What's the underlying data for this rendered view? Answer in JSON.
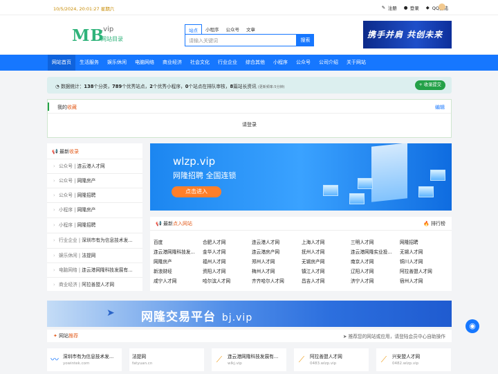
{
  "topbar": {
    "date": "10/5/2024, 20:01:27 星期六",
    "register": "注册",
    "login": "登录",
    "qq_login": "QQ登陆"
  },
  "logo": {
    "mb": "MB",
    "vip": ".vip",
    "cn": "网站目录"
  },
  "search": {
    "tabs": [
      "站点",
      "小程序",
      "公众号",
      "文章"
    ],
    "placeholder": "请输入关键词",
    "button": "搜索"
  },
  "header_banner": "携手并肩 共创未来",
  "nav": [
    "网站首页",
    "生活服务",
    "娱乐休闲",
    "电脑网络",
    "商业经济",
    "社会文化",
    "行业企业",
    "综合其他",
    "小程序",
    "公众号",
    "公司介绍",
    "关于网站"
  ],
  "stats": {
    "label": "数据统计：",
    "cat_count": "138",
    "cat_text": "个分类，",
    "good_count": "789",
    "good_text": "个优秀站点，",
    "mini_count": "2",
    "mini_text": "个优秀小程序，",
    "queue_count": "0",
    "queue_text": "个站点在排队审核，",
    "news_count": "8",
    "news_text": "篇站长资讯",
    "update_note": "(更新频率:5分钟)",
    "submit_button": "收录提交"
  },
  "favorites": {
    "title_a": "我的",
    "title_b": "收藏",
    "edit": "编辑",
    "login_prompt": "请登录"
  },
  "latest": {
    "title_a": "最新",
    "title_b": "收录",
    "items": [
      {
        "cat": "公众号",
        "name": "连云港人才网"
      },
      {
        "cat": "公众号",
        "name": "网隆房产"
      },
      {
        "cat": "公众号",
        "name": "网隆招聘"
      },
      {
        "cat": "小程序",
        "name": "网隆房产"
      },
      {
        "cat": "小程序",
        "name": "网隆招聘"
      },
      {
        "cat": "行业企业",
        "name": "深圳市有为信息技术发..."
      },
      {
        "cat": "娱乐休闲",
        "name": "法提网"
      },
      {
        "cat": "电脑网络",
        "name": "连云港网隆科技发展有..."
      },
      {
        "cat": "商业经济",
        "name": "阿拉善盟人才网"
      }
    ]
  },
  "ad_wlzp": {
    "domain": "wlzp.vip",
    "slogan": "网隆招聘  全国连锁",
    "button": "点击进入"
  },
  "hot": {
    "title_a": "最新",
    "title_b": "点入网站",
    "ranking": "排行榜",
    "rows": [
      [
        "百度",
        "合肥人才网",
        "连云港人才网",
        "上海人才网",
        "三明人才网",
        "网隆招聘"
      ],
      [
        "连云港网隆科技发...",
        "金华人才网",
        "连云港房产网",
        "抚州人才网",
        "连云港网隆实业投...",
        "无锡人才网"
      ],
      [
        "网隆房产",
        "福州人才网",
        "郑州人才网",
        "无锡房产网",
        "南京人才网",
        "铜川人才网"
      ],
      [
        "新浪财经",
        "资阳人才网",
        "梅州人才网",
        "镇江人才网",
        "辽阳人才网",
        "阿拉善盟人才网"
      ],
      [
        "咸宁人才网",
        "哈尔滨人才网",
        "齐齐哈尔人才网",
        "昌吉人才网",
        "济宁人才网",
        "宿州人才网"
      ]
    ]
  },
  "ad_bj": {
    "text": "网隆交易平台",
    "domain": "bj.vip"
  },
  "recommend": {
    "title_a": "网站",
    "title_b": "推荐",
    "note": "推荐您的网站或应用，请登陆会员中心自助操作",
    "cards": [
      {
        "name": "深圳市有为信息技术发...",
        "url": "yowintek.com"
      },
      {
        "name": "法提网",
        "url": "fatyuan.cn"
      },
      {
        "name": "连云港网隆科技发展有...",
        "url": "wlkj.vip"
      },
      {
        "name": "阿拉善盟人才网",
        "url": "0483.wlzp.vip"
      },
      {
        "name": "兴安盟人才网",
        "url": "0482.wlzp.vip"
      }
    ]
  },
  "colors": {
    "primary": "#1677ff",
    "green": "#24a148",
    "orange": "#e35d1e"
  }
}
